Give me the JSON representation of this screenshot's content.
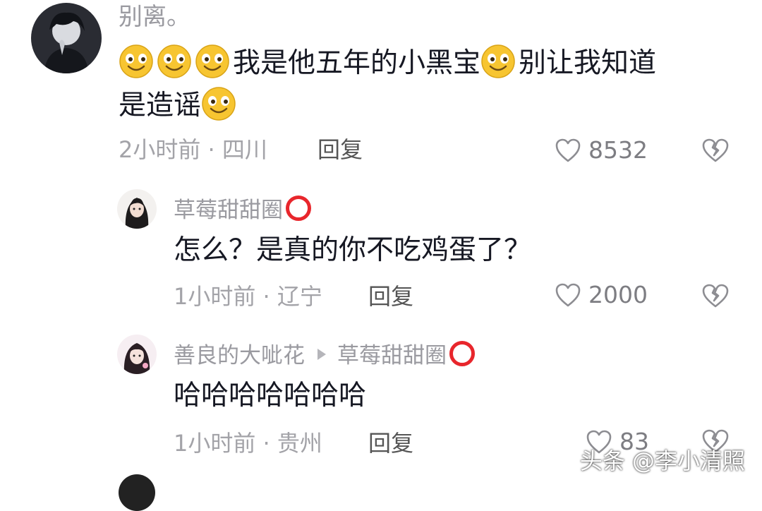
{
  "comments": [
    {
      "username": "别离。",
      "text_line1": "我是他五年的小黑宝",
      "text_line1b": "别让我知道",
      "text_line2": "是造谣",
      "time": "2小时前",
      "location": "四川",
      "reply_label": "回复",
      "likes": "8532",
      "emoji": "grin-face-icon"
    },
    {
      "username": "草莓甜甜圈",
      "text": "怎么？是真的你不吃鸡蛋了？",
      "time": "1小时前",
      "location": "辽宁",
      "reply_label": "回复",
      "likes": "2000"
    },
    {
      "username": "善良的大呲花",
      "reply_to": "草莓甜甜圈",
      "text": "哈哈哈哈哈哈哈",
      "time": "1小时前",
      "location": "贵州",
      "reply_label": "回复",
      "likes": "83"
    }
  ],
  "meta_separator": " · ",
  "watermark": "头条 @李小清照",
  "colors": {
    "username": "#9a9aa0",
    "text": "#161823",
    "meta": "#a3a3a8",
    "badge": "#e8262c",
    "emoji_fill": "#f7c531"
  }
}
